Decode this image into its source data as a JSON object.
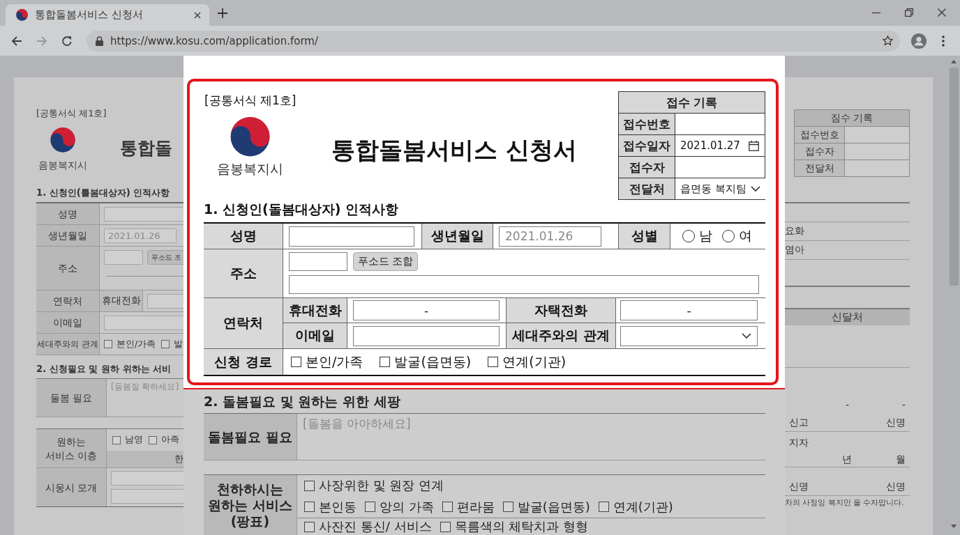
{
  "browser": {
    "tab_title": "통합돌봄서비스 신청서",
    "url": "https://www.kosu.com/application.form/",
    "nav_buttons": [
      {
        "kind": "back",
        "disabled": false
      },
      {
        "kind": "forward",
        "disabled": true
      },
      {
        "kind": "reload",
        "disabled": false
      }
    ]
  },
  "background_left": {
    "form_number": "[공통서식 제1호]",
    "org_name": "음봉복지시",
    "title": "통합돌",
    "section1_title": "1. 신청인(틀봄대상자) 인적사항",
    "rows": [
      {
        "kind": "input",
        "label": "성명"
      },
      {
        "kind": "date",
        "label": "생년월일",
        "placeholder": "2021.01.26"
      },
      {
        "kind": "address",
        "label": "주소",
        "button": "푸소드 조"
      },
      {
        "kind": "contact",
        "label": "연락처",
        "sublabel": "휴대전화"
      },
      {
        "kind": "input",
        "label": "이메일"
      },
      {
        "kind": "checks",
        "label": "세대주와의 관계",
        "options": [
          {
            "label": "본인/가족",
            "checked": false
          },
          {
            "label": "발",
            "checked": false
          }
        ]
      }
    ],
    "section2_title": "2. 신청필요 및 원하 위하는 서비",
    "need": {
      "label": "둘봄 필요",
      "placeholder": "[둠봄잘 확하세요]"
    },
    "service": {
      "label_lines": [
        "원하는",
        "서비스 이층"
      ],
      "options": [
        {
          "label": "남영",
          "checked": false
        },
        {
          "label": "아족",
          "checked": false
        }
      ],
      "subheader": "한"
    },
    "usage": {
      "label": "시웅시 모개"
    }
  },
  "form": {
    "form_number": "[공통서식 제1호]",
    "org_name": "음봉복지시",
    "title": "통합돌봄서비스 신청서",
    "receipt": {
      "title": "접수 기록",
      "rows": [
        {
          "kind": "blank",
          "label": "접수번호"
        },
        {
          "kind": "date",
          "label": "접수일자",
          "value": "2021.01.27"
        },
        {
          "kind": "blank",
          "label": "접수자"
        },
        {
          "kind": "select",
          "label": "전달처",
          "value": "읍면동 복지팀"
        }
      ]
    },
    "section1": {
      "title": "1. 신청인(돌봄대상자) 인적사항",
      "name_label": "성명",
      "birth_label": "생년월일",
      "birth_placeholder": "2021.01.26",
      "gender_label": "성별",
      "gender_options": [
        {
          "label": "남",
          "selected": false
        },
        {
          "label": "여",
          "selected": false
        }
      ],
      "address_label": "주소",
      "zip_button": "푸소드 조합",
      "contact_label": "연락처",
      "contact_fields": [
        {
          "kind": "input",
          "label": "휴대전화",
          "value": "-"
        },
        {
          "kind": "input",
          "label": "자택전화",
          "value": "-"
        },
        {
          "kind": "input",
          "label": "이메일"
        },
        {
          "kind": "select",
          "label": "세대주와의 관계"
        }
      ],
      "route_label": "신청 경로",
      "route_options": [
        {
          "label": "본인/가족",
          "checked": false
        },
        {
          "label": "발굴(읍면동)",
          "checked": false
        },
        {
          "label": "연계(기관)",
          "checked": false
        }
      ]
    },
    "section2": {
      "title": "2. 돌봄필요 및 원하는 위한 세팡",
      "need_label": "돌봄필요 필요",
      "need_placeholder": "[돌봄을 아아하세요]",
      "service_label_lines": [
        "천하하시는",
        "원하는 서비스",
        "(팡표)"
      ],
      "service_rows": [
        {
          "options": [
            {
              "label": "사장위한 및 원장 연계",
              "checked": false
            }
          ]
        },
        {
          "options": [
            {
              "label": "본인동",
              "checked": false
            },
            {
              "label": "앙의 가족",
              "checked": false
            },
            {
              "label": "편라뭄",
              "checked": false
            },
            {
              "label": "발굴(읍면동)",
              "checked": false
            },
            {
              "label": "연계(기관)",
              "checked": false
            }
          ]
        },
        {
          "options": [
            {
              "label": "사잔진 통신/ 서비스",
              "checked": false
            },
            {
              "label": "목름색의 체탁치과 형형",
              "checked": false
            }
          ]
        }
      ]
    }
  },
  "background_right": {
    "receipt": {
      "title": "짐수 기록",
      "rows": [
        "접수번호",
        "접수자",
        "전달처"
      ]
    },
    "list_items": [
      "요화",
      "염아"
    ],
    "header": "신달처",
    "blocks": [
      {
        "lines": [
          {
            "middle": "-",
            "right": "-"
          },
          {
            "left": "신고",
            "right": "신명"
          }
        ]
      },
      {
        "lines": [
          {
            "left": "지자"
          },
          {
            "middle": "년",
            "right": "월"
          }
        ]
      },
      {
        "lines": [
          {
            "left": "신명",
            "right": "신명"
          }
        ]
      }
    ],
    "note": "차의 사정잉 복지만 을 수자맙니다."
  }
}
